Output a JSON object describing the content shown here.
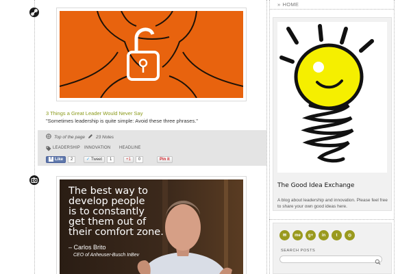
{
  "posts": [
    {
      "type_icon": "link-icon",
      "title": "3 Things a Great Leader Would Never Say",
      "quote": "\"Sometimes leadership is quite simple: Avoid these three phrases.\"",
      "meta": {
        "top_of_page": "Top of the page",
        "notes": "23 Notes"
      },
      "tags": [
        "LEADERSHIP",
        "INNOVATION",
        "HEADLINE"
      ],
      "share": {
        "like_label": "Like",
        "like_count": "2",
        "tweet_label": "Tweet",
        "tweet_count": "1",
        "gplus_label": "+1",
        "gplus_count": "0",
        "pinit_label": "Pin it"
      },
      "image_bg": "#e8630e"
    },
    {
      "type_icon": "camera-icon",
      "quote_lines": [
        "The best way to",
        "develop people",
        "is to constantly",
        "get them out of",
        "their comfort zone."
      ],
      "author": "– Carlos Brito",
      "author_role": "CEO of Anheuser-Busch InBev"
    }
  ],
  "sidebar": {
    "home_label": "HOME",
    "blog_title": "The Good Idea Exchange",
    "blog_description": "A blog about leadership and innovation. Please feel free to share your own good ideas here.",
    "social_icons": [
      "email-icon",
      "me-icon",
      "google-plus-icon",
      "linkedin-icon",
      "twitter-icon",
      "globe-icon"
    ],
    "social_labels": [
      "✉",
      "me",
      "g+",
      "in",
      "t",
      "◎"
    ],
    "search_label": "SEARCH POSTS",
    "search_placeholder": ""
  },
  "colors": {
    "accent_olive": "#9a9a1e",
    "title_green": "#8a9a1a",
    "bulb_yellow": "#f5ef00",
    "image_orange": "#e8630e"
  }
}
